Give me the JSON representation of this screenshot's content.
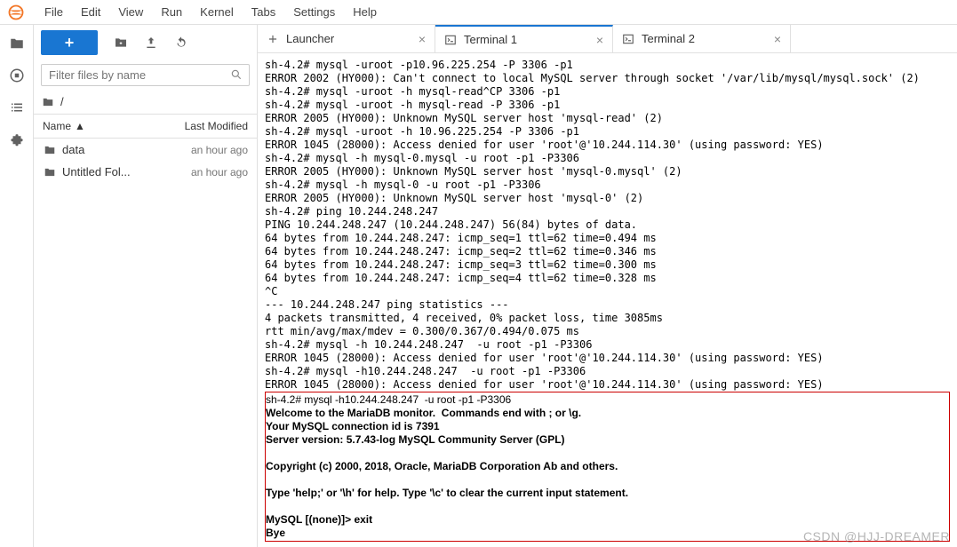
{
  "menu": {
    "items": [
      "File",
      "Edit",
      "View",
      "Run",
      "Kernel",
      "Tabs",
      "Settings",
      "Help"
    ]
  },
  "filter": {
    "placeholder": "Filter files by name"
  },
  "breadcrumb": {
    "root": "/"
  },
  "list_header": {
    "name": "Name",
    "modified": "Last Modified"
  },
  "files": [
    {
      "name": "data",
      "modified": "an hour ago"
    },
    {
      "name": "Untitled Fol...",
      "modified": "an hour ago"
    }
  ],
  "tabs": [
    {
      "label": "Launcher",
      "icon": "plus",
      "active": false
    },
    {
      "label": "Terminal 1",
      "icon": "term",
      "active": true
    },
    {
      "label": "Terminal 2",
      "icon": "term",
      "active": false
    }
  ],
  "terminal": {
    "lines": [
      "sh-4.2# mysql -uroot -p10.96.225.254 -P 3306 -p1",
      "ERROR 2002 (HY000): Can't connect to local MySQL server through socket '/var/lib/mysql/mysql.sock' (2)",
      "sh-4.2# mysql -uroot -h mysql-read^CP 3306 -p1",
      "sh-4.2# mysql -uroot -h mysql-read -P 3306 -p1",
      "ERROR 2005 (HY000): Unknown MySQL server host 'mysql-read' (2)",
      "sh-4.2# mysql -uroot -h 10.96.225.254 -P 3306 -p1",
      "ERROR 1045 (28000): Access denied for user 'root'@'10.244.114.30' (using password: YES)",
      "sh-4.2# mysql -h mysql-0.mysql -u root -p1 -P3306",
      "ERROR 2005 (HY000): Unknown MySQL server host 'mysql-0.mysql' (2)",
      "sh-4.2# mysql -h mysql-0 -u root -p1 -P3306",
      "ERROR 2005 (HY000): Unknown MySQL server host 'mysql-0' (2)",
      "sh-4.2# ping 10.244.248.247",
      "PING 10.244.248.247 (10.244.248.247) 56(84) bytes of data.",
      "64 bytes from 10.244.248.247: icmp_seq=1 ttl=62 time=0.494 ms",
      "64 bytes from 10.244.248.247: icmp_seq=2 ttl=62 time=0.346 ms",
      "64 bytes from 10.244.248.247: icmp_seq=3 ttl=62 time=0.300 ms",
      "64 bytes from 10.244.248.247: icmp_seq=4 ttl=62 time=0.328 ms",
      "^C",
      "--- 10.244.248.247 ping statistics ---",
      "4 packets transmitted, 4 received, 0% packet loss, time 3085ms",
      "rtt min/avg/max/mdev = 0.300/0.367/0.494/0.075 ms",
      "sh-4.2# mysql -h 10.244.248.247  -u root -p1 -P3306",
      "ERROR 1045 (28000): Access denied for user 'root'@'10.244.114.30' (using password: YES)",
      "sh-4.2# mysql -h10.244.248.247  -u root -p1 -P3306",
      "ERROR 1045 (28000): Access denied for user 'root'@'10.244.114.30' (using password: YES)"
    ],
    "boxed": [
      "sh-4.2# mysql -h10.244.248.247  -u root -p1 -P3306",
      "Welcome to the MariaDB monitor.  Commands end with ; or \\g.",
      "Your MySQL connection id is 7391",
      "Server version: 5.7.43-log MySQL Community Server (GPL)",
      "",
      "Copyright (c) 2000, 2018, Oracle, MariaDB Corporation Ab and others.",
      "",
      "Type 'help;' or '\\h' for help. Type '\\c' to clear the current input statement.",
      "",
      "MySQL [(none)]> exit",
      "Bye"
    ]
  },
  "watermark": "CSDN @HJJ-DREAMER"
}
